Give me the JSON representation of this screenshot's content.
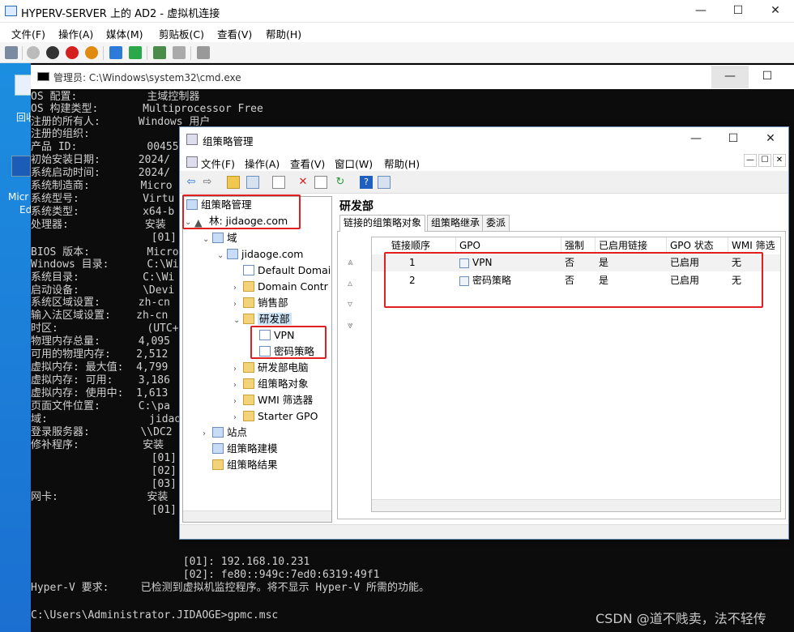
{
  "vm": {
    "title": "HYPERV-SERVER 上的 AD2 - 虚拟机连接",
    "menu": [
      "文件(F)",
      "操作(A)",
      "媒体(M)",
      "剪贴板(C)",
      "查看(V)",
      "帮助(H)"
    ],
    "win_min": "—",
    "win_max": "☐",
    "win_close": "✕"
  },
  "desktop": {
    "recycle_label": "回收",
    "edge_label_1": "Micr",
    "edge_label_2": "Ed"
  },
  "cmd": {
    "title": "管理员: C:\\Windows\\system32\\cmd.exe",
    "lines": [
      "OS 配置:           主域控制器",
      "OS 构建类型:       Multiprocessor Free",
      "注册的所有人:      Windows 用户",
      "注册的组织:",
      "产品 ID:           00455",
      "初始安装日期:      2024/",
      "系统启动时间:      2024/",
      "系统制造商:        Micro",
      "系统型号:          Virtu",
      "系统类型:          x64-b",
      "处理器:            安装",
      "                   [01]:",
      "BIOS 版本:         Micro",
      "Windows 目录:      C:\\Wi",
      "系统目录:          C:\\Wi",
      "启动设备:          \\Devi",
      "系统区域设置:      zh-cn",
      "输入法区域设置:    zh-cn",
      "时区:              (UTC+",
      "物理内存总量:      4,095",
      "可用的物理内存:    2,512",
      "虚拟内存: 最大值:  4,799",
      "虚拟内存: 可用:    3,186",
      "虚拟内存: 使用中:  1,613",
      "页面文件位置:      C:\\pa",
      "域:                jidao",
      "登录服务器:        \\\\DC2",
      "修补程序:          安装",
      "                   [01]:",
      "                   [02]:",
      "                   [03]:",
      "网卡:              安装",
      "                   [01]:"
    ],
    "tail": [
      "                        [01]: 192.168.10.231",
      "                        [02]: fe80::949c:7ed0:6319:49f1",
      "Hyper-V 要求:     已检测到虚拟机监控程序。将不显示 Hyper-V 所需的功能。",
      "",
      "C:\\Users\\Administrator.JIDAOGE>gpmc.msc"
    ]
  },
  "gpmc": {
    "title": "组策略管理",
    "menu": [
      "文件(F)",
      "操作(A)",
      "查看(V)",
      "窗口(W)",
      "帮助(H)"
    ],
    "tree": {
      "root": "组策略管理",
      "forest": "林: jidaoge.com",
      "domains": "域",
      "domain": "jidaoge.com",
      "default_domain": "Default Domai",
      "domain_controllers": "Domain Contr",
      "ou_sales": "销售部",
      "ou_rd": "研发部",
      "link_vpn": "VPN",
      "link_pwd": "密码策略",
      "ou_rd_pc": "研发部电脑",
      "gpo_objects": "组策略对象",
      "wmi_filters": "WMI 筛选器",
      "starter_gpo": "Starter GPO",
      "sites": "站点",
      "modeling": "组策略建模",
      "results": "组策略结果"
    },
    "pane_title": "研发部",
    "tabs": [
      "链接的组策略对象",
      "组策略继承",
      "委派"
    ],
    "columns": [
      "链接顺序",
      "GPO",
      "强制",
      "已启用链接",
      "GPO 状态",
      "WMI 筛选"
    ],
    "rows": [
      {
        "order": "1",
        "gpo": "VPN",
        "enforced": "否",
        "link_enabled": "是",
        "status": "已启用",
        "wmi": "无"
      },
      {
        "order": "2",
        "gpo": "密码策略",
        "enforced": "否",
        "link_enabled": "是",
        "status": "已启用",
        "wmi": "无"
      }
    ]
  },
  "watermark": "CSDN @道不贱卖，法不轻传"
}
